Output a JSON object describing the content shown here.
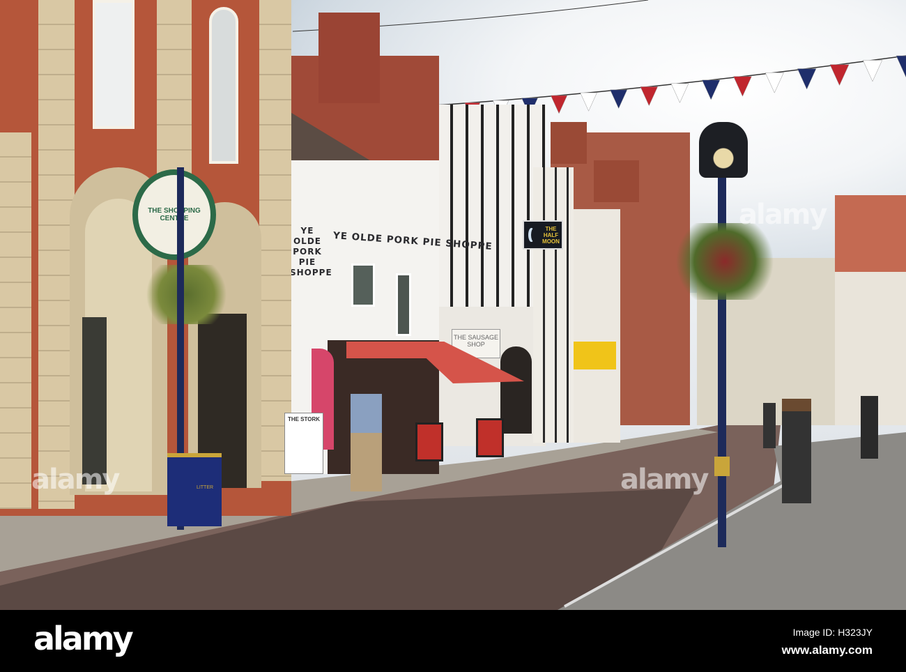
{
  "scene": {
    "pork_pie_side_sign": [
      "YE OLDE",
      "PORK PIE",
      "SHOPPE"
    ],
    "pork_pie_front_sign": "YE OLDE PORK PIE SHOPPE",
    "pub_sign": [
      "THE",
      "HALF",
      "MOON"
    ],
    "shopping_centre_sign": "THE SHOPPING CENTRE",
    "sausage_shop_sign": "THE SAUSAGE SHOP",
    "stork_board": "THE STORK",
    "bin_label": "LITTER"
  },
  "watermark": {
    "text": "alamy"
  },
  "footer": {
    "logo": "alamy",
    "image_id": "Image ID: H323JY",
    "url": "www.alamy.com"
  },
  "colors": {
    "brick": "#b5563a",
    "awning": "#d5544a",
    "sky": "#e6eaee",
    "road": "#8a6f66"
  }
}
